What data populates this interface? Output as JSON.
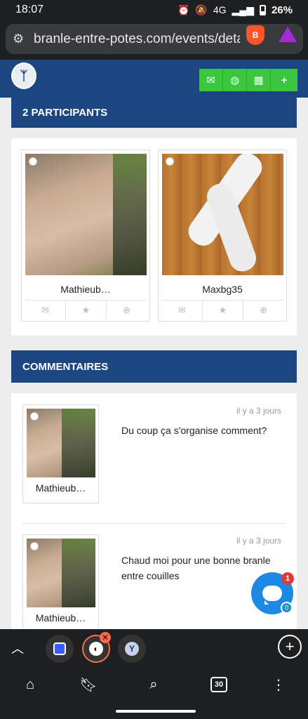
{
  "status_bar": {
    "time": "18:07",
    "network": "4G",
    "battery": "26%"
  },
  "browser": {
    "url": "branle-entre-potes.com/events/details"
  },
  "site": {
    "header_actions": [
      {
        "icon": "envelope-icon",
        "glyph": "✉"
      },
      {
        "icon": "globe-icon",
        "glyph": "◍"
      },
      {
        "icon": "grid-icon",
        "glyph": "▦"
      },
      {
        "icon": "plus-icon",
        "glyph": "+"
      }
    ]
  },
  "participants": {
    "title": "2 PARTICIPANTS",
    "cards": [
      {
        "name": "Mathieub…"
      },
      {
        "name": "Maxbg35"
      }
    ]
  },
  "comments": {
    "title": "COMMENTAIRES",
    "items": [
      {
        "author": "Mathieub…",
        "time": "il y a 3 jours",
        "text": "Du coup ça s'organise comment?"
      },
      {
        "author": "Mathieub…",
        "time": "il y a 3 jours",
        "text": "Chaud moi pour une bonne branle entre couilles"
      }
    ]
  },
  "chat": {
    "badge": "1",
    "count": "0",
    "accent": "#1e88e5"
  },
  "bottom_bar": {
    "tab_count": "30"
  },
  "colors": {
    "brand": "#1c4680",
    "action_green": "#3cc53f"
  }
}
